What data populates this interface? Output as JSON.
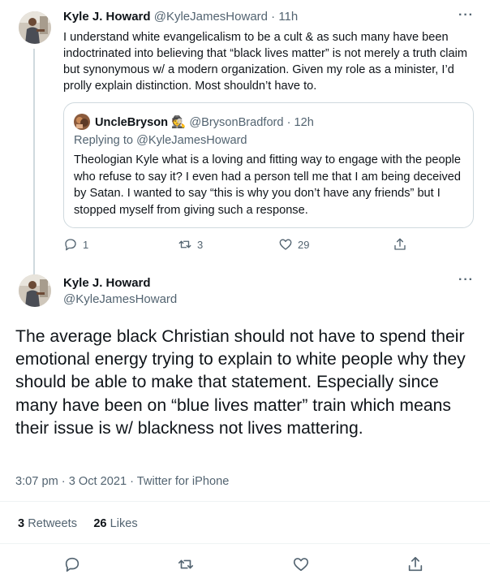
{
  "tweet1": {
    "author_name": "Kyle J. Howard",
    "author_meta": "@KyleJamesHoward · 11h",
    "text": "I understand white evangelicalism to be a cult & as such many have been indoctrinated into believing that “black lives matter” is not merely a truth claim but synonymous w/ a modern organization. Given my role as a minister, I’d prolly explain distinction. Most shouldn’t have to.",
    "more": "···",
    "quote": {
      "author_name": "UncleBryson",
      "author_emoji": "🕵",
      "author_meta": "@BrysonBradford · 12h",
      "replying_label": "Replying to",
      "replying_handle": "@KyleJamesHoward",
      "text": "Theologian Kyle what is a loving and fitting way to engage with the people who refuse to say it? I even had a person tell me that I am being deceived by Satan. I wanted to say “this is why you don’t have any friends” but I stopped myself from giving such a response."
    },
    "actions": {
      "reply_count": "1",
      "retweet_count": "3",
      "like_count": "29"
    }
  },
  "tweet2": {
    "author_name": "Kyle J. Howard",
    "author_handle": "@KyleJamesHoward",
    "more": "···",
    "text": "The average black Christian should not have to spend their emotional energy trying to explain to white people why they should be able to make that statement. Especially since many have been on “blue lives matter” train which means their issue is w/ blackness not lives mattering.",
    "timestamp": "3:07 pm · 3 Oct 2021 · Twitter for iPhone",
    "retweets_count": "3",
    "retweets_label": "Retweets",
    "likes_count": "26",
    "likes_label": "Likes"
  },
  "icons": {
    "reply": "reply-icon",
    "retweet": "retweet-icon",
    "like": "heart-icon",
    "share": "share-icon",
    "more": "more-icon"
  },
  "colors": {
    "text": "#0f1419",
    "secondary": "#536471",
    "border": "#cfd9de"
  }
}
